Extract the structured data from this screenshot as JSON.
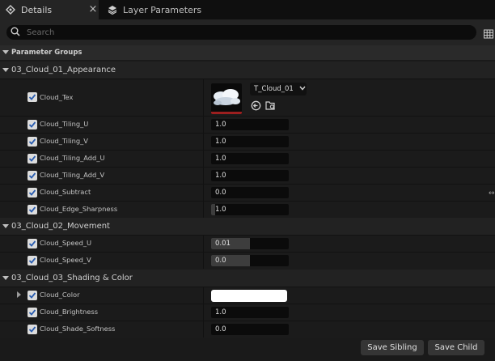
{
  "tabs": [
    {
      "label": "Details",
      "icon": "details-icon",
      "active": true
    },
    {
      "label": "Layer Parameters",
      "icon": "layers-icon",
      "active": false
    }
  ],
  "search": {
    "placeholder": "Search",
    "value": ""
  },
  "parameter_groups_label": "Parameter Groups",
  "groups": [
    {
      "name": "03_Cloud_01_Appearance",
      "params": [
        {
          "label": "Cloud_Tex",
          "type": "texture",
          "texture": "T_Cloud_01",
          "checked": true
        },
        {
          "label": "Cloud_Tiling_U",
          "value": "1.0",
          "checked": true
        },
        {
          "label": "Cloud_Tiling_V",
          "value": "1.0",
          "checked": true
        },
        {
          "label": "Cloud_Tiling_Add_U",
          "value": "1.0",
          "checked": true
        },
        {
          "label": "Cloud_Tiling_Add_V",
          "value": "1.0",
          "checked": true
        },
        {
          "label": "Cloud_Subtract",
          "value": "0.0",
          "checked": true
        },
        {
          "label": "Cloud_Edge_Sharpness",
          "value": "1.0",
          "checked": true,
          "fill": 0.05
        }
      ]
    },
    {
      "name": "03_Cloud_02_Movement",
      "params": [
        {
          "label": "Cloud_Speed_U",
          "value": "0.01",
          "checked": true,
          "fill": 0.5
        },
        {
          "label": "Cloud_Speed_V",
          "value": "0.0",
          "checked": true,
          "fill": 0.5
        }
      ]
    },
    {
      "name": "03_Cloud_03_Shading & Color",
      "params": [
        {
          "label": "Cloud_Color",
          "type": "color",
          "color": "#ffffff",
          "checked": true
        },
        {
          "label": "Cloud_Brightness",
          "value": "1.0",
          "checked": true
        },
        {
          "label": "Cloud_Shade_Softness",
          "value": "0.0",
          "checked": true
        }
      ]
    }
  ],
  "buttons": {
    "save_sibling": "Save Sibling",
    "save_child": "Save Child"
  },
  "colors": {
    "checkbox": "#dcdcdc",
    "accent": "#2a5db0",
    "tex_bar": "#9b1f1f"
  }
}
